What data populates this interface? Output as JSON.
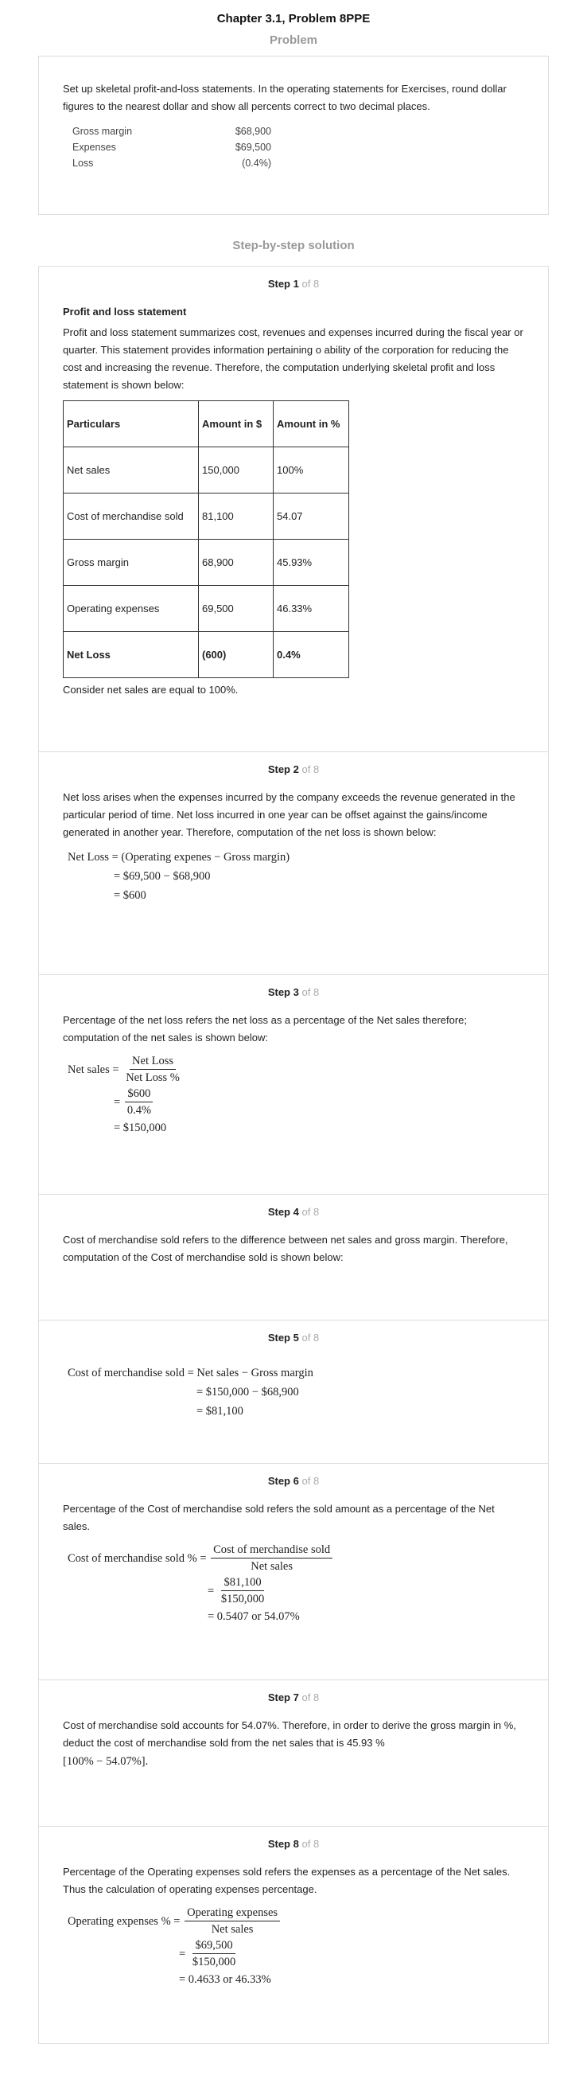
{
  "chapter_title": "Chapter 3.1, Problem 8PPE",
  "problem": {
    "heading": "Problem",
    "text": "Set up skeletal profit-and-loss statements. In the operating statements for Exercises, round dollar figures to the nearest dollar and show all percents correct to two decimal places.",
    "rows": [
      {
        "label": "Gross margin",
        "value": "$68,900"
      },
      {
        "label": "Expenses",
        "value": "$69,500"
      },
      {
        "label": "Loss",
        "value": "(0.4%)"
      }
    ]
  },
  "solution_heading": "Step-by-step solution",
  "step_word": "Step",
  "of_text": "of 8",
  "steps": {
    "s1": {
      "num": "1",
      "subheading": "Profit and loss statement",
      "text": "Profit and loss statement summarizes cost, revenues and expenses incurred during the fiscal year or quarter. This statement provides information pertaining o ability of the corporation for reducing the cost and increasing the revenue. Therefore, the computation underlying skeletal profit and loss statement is shown below:",
      "table": {
        "headers": [
          "Particulars",
          "Amount in $",
          "Amount in %"
        ],
        "rows": [
          [
            "Net sales",
            "150,000",
            "100%"
          ],
          [
            "Cost of merchandise sold",
            "81,100",
            "54.07"
          ],
          [
            "Gross margin",
            "68,900",
            "45.93%"
          ],
          [
            "Operating expenses",
            "69,500",
            "46.33%"
          ],
          [
            "Net Loss",
            "(600)",
            "0.4%"
          ]
        ]
      },
      "note": "Consider net sales are equal to 100%."
    },
    "s2": {
      "num": "2",
      "text": "Net loss arises when the expenses incurred by the company exceeds the revenue generated in the particular period of time. Net loss incurred in one year can be offset against the gains/income generated in another year. Therefore, computation of the net loss is shown below:",
      "lhs": "Net Loss",
      "eq1": "= (Operating expenes − Gross margin)",
      "eq2": "= $69,500 − $68,900",
      "eq3": "= $600"
    },
    "s3": {
      "num": "3",
      "text": "Percentage of the net loss refers the net loss as a percentage of the Net sales therefore; computation of the net sales is shown below:",
      "lhs": "Net sales",
      "f1_num": "Net Loss",
      "f1_den": "Net Loss %",
      "f2_num": "$600",
      "f2_den": "0.4%",
      "eq3": "= $150,000"
    },
    "s4": {
      "num": "4",
      "text": "Cost of merchandise sold refers to the difference between net sales and gross margin. Therefore, computation of the Cost of merchandise sold is shown below:"
    },
    "s5": {
      "num": "5",
      "lhs": "Cost of merchandise sold",
      "eq1": "= Net sales − Gross margin",
      "eq2": "= $150,000 − $68,900",
      "eq3": "= $81,100"
    },
    "s6": {
      "num": "6",
      "text": "Percentage of the Cost of merchandise sold refers the sold amount as a percentage of the Net sales.",
      "lhs": "Cost of merchandise sold %",
      "f1_num": "Cost of merchandise sold",
      "f1_den": "Net sales",
      "f2_num": "$81,100",
      "f2_den": "$150,000",
      "eq3": "= 0.5407 or 54.07%"
    },
    "s7": {
      "num": "7",
      "text": "Cost of merchandise sold accounts for 54.07%. Therefore, in order to derive the gross margin in %, deduct the cost of merchandise sold from the net sales that is 45.93 %",
      "bracket": "[100% − 54.07%]."
    },
    "s8": {
      "num": "8",
      "text": "Percentage of the Operating expenses sold refers the expenses as a percentage of the Net sales. Thus the calculation of operating expenses percentage.",
      "lhs": "Operating expenses %",
      "f1_num": "Operating expenses",
      "f1_den": "Net sales",
      "f2_num": "$69,500",
      "f2_den": "$150,000",
      "eq3": "= 0.4633 or 46.33%"
    }
  }
}
